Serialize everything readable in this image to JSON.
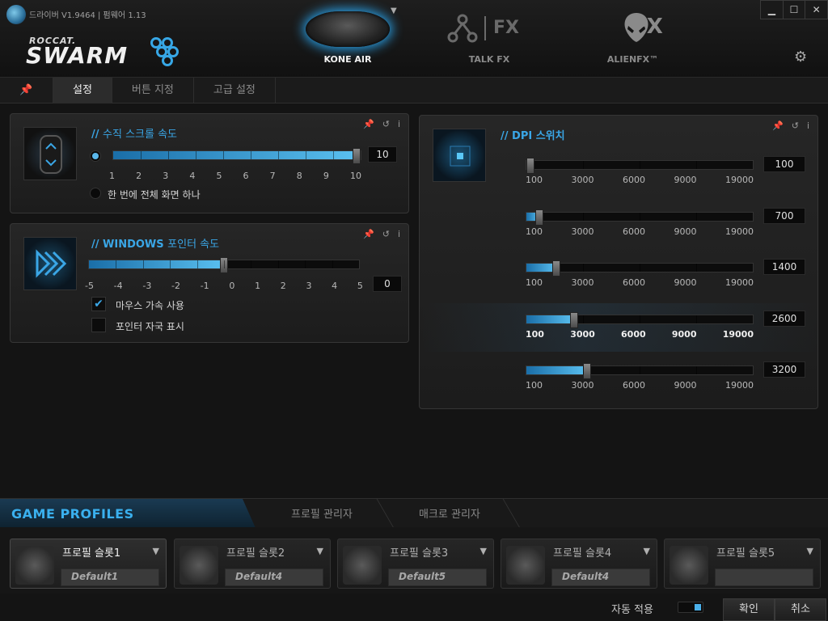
{
  "window": {
    "version": "드라이버 V1.9464 | 펌웨어 1.13",
    "controls": {
      "minimize": "▁",
      "maximize": "☐",
      "close": "✕"
    }
  },
  "brand": {
    "roccat": "ROCCAT.",
    "swarm": "SWARM"
  },
  "device_tabs": [
    {
      "label": "KONE AIR"
    },
    {
      "label": "TALK FX",
      "icon_text": "FX"
    },
    {
      "label": "ALIENFX™",
      "icon_text": "FX"
    }
  ],
  "sub_tabs": [
    "설정",
    "버튼 지정",
    "고급 설정"
  ],
  "scroll_panel": {
    "title_prefix": "//",
    "title": "수직 스크롤 속도",
    "ticks": [
      "1",
      "2",
      "3",
      "4",
      "5",
      "6",
      "7",
      "8",
      "9",
      "10"
    ],
    "value": "10",
    "value_fraction": 1.0,
    "option_full_screen": "한 번에 전체 화면 하나"
  },
  "pointer_panel": {
    "title_prefix": "//",
    "title_a": "WINDOWS",
    "title_b": "포인터 속도",
    "ticks": [
      "-5",
      "-4",
      "-3",
      "-2",
      "-1",
      "0",
      "1",
      "2",
      "3",
      "4",
      "5"
    ],
    "value": "0",
    "value_fraction": 0.5,
    "opt_accel": "마우스 가속 사용",
    "opt_accel_checked": true,
    "opt_trail": "포인터 자국 표시",
    "opt_trail_checked": false
  },
  "dpi_panel": {
    "title_prefix": "//",
    "title": "DPI 스위치",
    "ticks": [
      "100",
      "3000",
      "6000",
      "9000",
      "19000"
    ],
    "rows": [
      {
        "value": "100",
        "fraction": 0.0
      },
      {
        "value": "700",
        "fraction": 0.04
      },
      {
        "value": "1400",
        "fraction": 0.12
      },
      {
        "value": "2600",
        "fraction": 0.2
      },
      {
        "value": "3200",
        "fraction": 0.26
      }
    ],
    "selected_row": 3
  },
  "profiles": {
    "title": "GAME PROFILES",
    "tabs": [
      "프로필 관리자",
      "매크로 관리자"
    ],
    "slots": [
      {
        "name": "프로필 슬롯1",
        "profile": "Default1"
      },
      {
        "name": "프로필 슬롯2",
        "profile": "Default4"
      },
      {
        "name": "프로필 슬롯3",
        "profile": "Default5"
      },
      {
        "name": "프로필 슬롯4",
        "profile": "Default4"
      },
      {
        "name": "프로필 슬롯5",
        "profile": ""
      }
    ],
    "active_slot": 0
  },
  "footer": {
    "auto_apply": "자동 적용",
    "ok": "확인",
    "cancel": "취소"
  },
  "colors": {
    "accent": "#3aa6e6",
    "bg": "#141414"
  }
}
